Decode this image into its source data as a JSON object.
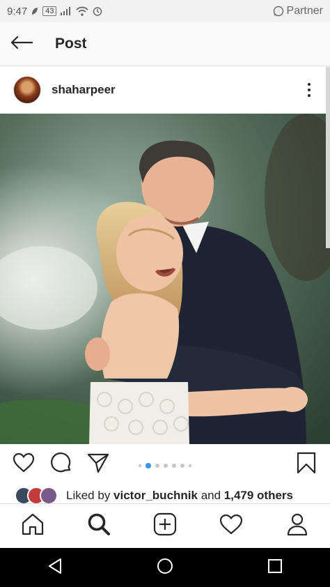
{
  "status_bar": {
    "time": "9:47",
    "battery": "43",
    "partner_label": "Partner"
  },
  "header": {
    "title": "Post"
  },
  "post": {
    "username": "shaharpeer",
    "carousel": {
      "count": 6,
      "active_index": 1
    }
  },
  "likes": {
    "prefix": "Liked by ",
    "user": "victor_buchnik",
    "middle": " and ",
    "others": "1,479 others"
  },
  "icons": {
    "back": "back-arrow-icon",
    "more": "more-vertical-icon",
    "like": "heart-icon",
    "comment": "comment-icon",
    "share": "send-icon",
    "save": "bookmark-icon",
    "home": "home-icon",
    "search": "search-icon",
    "add": "add-post-icon",
    "activity": "heart-icon",
    "profile": "profile-icon"
  },
  "colors": {
    "accent": "#3897f0",
    "text": "#262626"
  }
}
